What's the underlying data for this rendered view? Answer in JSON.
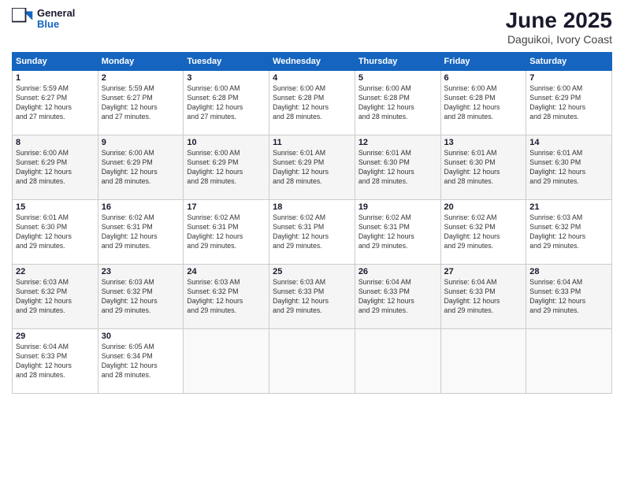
{
  "header": {
    "logo": {
      "general": "General",
      "blue": "Blue"
    },
    "title": "June 2025",
    "subtitle": "Daguikoi, Ivory Coast"
  },
  "weekdays": [
    "Sunday",
    "Monday",
    "Tuesday",
    "Wednesday",
    "Thursday",
    "Friday",
    "Saturday"
  ],
  "weeks": [
    [
      {
        "day": "1",
        "info": "Sunrise: 5:59 AM\nSunset: 6:27 PM\nDaylight: 12 hours\nand 27 minutes."
      },
      {
        "day": "2",
        "info": "Sunrise: 5:59 AM\nSunset: 6:27 PM\nDaylight: 12 hours\nand 27 minutes."
      },
      {
        "day": "3",
        "info": "Sunrise: 6:00 AM\nSunset: 6:28 PM\nDaylight: 12 hours\nand 27 minutes."
      },
      {
        "day": "4",
        "info": "Sunrise: 6:00 AM\nSunset: 6:28 PM\nDaylight: 12 hours\nand 28 minutes."
      },
      {
        "day": "5",
        "info": "Sunrise: 6:00 AM\nSunset: 6:28 PM\nDaylight: 12 hours\nand 28 minutes."
      },
      {
        "day": "6",
        "info": "Sunrise: 6:00 AM\nSunset: 6:28 PM\nDaylight: 12 hours\nand 28 minutes."
      },
      {
        "day": "7",
        "info": "Sunrise: 6:00 AM\nSunset: 6:29 PM\nDaylight: 12 hours\nand 28 minutes."
      }
    ],
    [
      {
        "day": "8",
        "info": "Sunrise: 6:00 AM\nSunset: 6:29 PM\nDaylight: 12 hours\nand 28 minutes."
      },
      {
        "day": "9",
        "info": "Sunrise: 6:00 AM\nSunset: 6:29 PM\nDaylight: 12 hours\nand 28 minutes."
      },
      {
        "day": "10",
        "info": "Sunrise: 6:00 AM\nSunset: 6:29 PM\nDaylight: 12 hours\nand 28 minutes."
      },
      {
        "day": "11",
        "info": "Sunrise: 6:01 AM\nSunset: 6:29 PM\nDaylight: 12 hours\nand 28 minutes."
      },
      {
        "day": "12",
        "info": "Sunrise: 6:01 AM\nSunset: 6:30 PM\nDaylight: 12 hours\nand 28 minutes."
      },
      {
        "day": "13",
        "info": "Sunrise: 6:01 AM\nSunset: 6:30 PM\nDaylight: 12 hours\nand 28 minutes."
      },
      {
        "day": "14",
        "info": "Sunrise: 6:01 AM\nSunset: 6:30 PM\nDaylight: 12 hours\nand 29 minutes."
      }
    ],
    [
      {
        "day": "15",
        "info": "Sunrise: 6:01 AM\nSunset: 6:30 PM\nDaylight: 12 hours\nand 29 minutes."
      },
      {
        "day": "16",
        "info": "Sunrise: 6:02 AM\nSunset: 6:31 PM\nDaylight: 12 hours\nand 29 minutes."
      },
      {
        "day": "17",
        "info": "Sunrise: 6:02 AM\nSunset: 6:31 PM\nDaylight: 12 hours\nand 29 minutes."
      },
      {
        "day": "18",
        "info": "Sunrise: 6:02 AM\nSunset: 6:31 PM\nDaylight: 12 hours\nand 29 minutes."
      },
      {
        "day": "19",
        "info": "Sunrise: 6:02 AM\nSunset: 6:31 PM\nDaylight: 12 hours\nand 29 minutes."
      },
      {
        "day": "20",
        "info": "Sunrise: 6:02 AM\nSunset: 6:32 PM\nDaylight: 12 hours\nand 29 minutes."
      },
      {
        "day": "21",
        "info": "Sunrise: 6:03 AM\nSunset: 6:32 PM\nDaylight: 12 hours\nand 29 minutes."
      }
    ],
    [
      {
        "day": "22",
        "info": "Sunrise: 6:03 AM\nSunset: 6:32 PM\nDaylight: 12 hours\nand 29 minutes."
      },
      {
        "day": "23",
        "info": "Sunrise: 6:03 AM\nSunset: 6:32 PM\nDaylight: 12 hours\nand 29 minutes."
      },
      {
        "day": "24",
        "info": "Sunrise: 6:03 AM\nSunset: 6:32 PM\nDaylight: 12 hours\nand 29 minutes."
      },
      {
        "day": "25",
        "info": "Sunrise: 6:03 AM\nSunset: 6:33 PM\nDaylight: 12 hours\nand 29 minutes."
      },
      {
        "day": "26",
        "info": "Sunrise: 6:04 AM\nSunset: 6:33 PM\nDaylight: 12 hours\nand 29 minutes."
      },
      {
        "day": "27",
        "info": "Sunrise: 6:04 AM\nSunset: 6:33 PM\nDaylight: 12 hours\nand 29 minutes."
      },
      {
        "day": "28",
        "info": "Sunrise: 6:04 AM\nSunset: 6:33 PM\nDaylight: 12 hours\nand 29 minutes."
      }
    ],
    [
      {
        "day": "29",
        "info": "Sunrise: 6:04 AM\nSunset: 6:33 PM\nDaylight: 12 hours\nand 28 minutes."
      },
      {
        "day": "30",
        "info": "Sunrise: 6:05 AM\nSunset: 6:34 PM\nDaylight: 12 hours\nand 28 minutes."
      },
      {
        "day": "",
        "info": ""
      },
      {
        "day": "",
        "info": ""
      },
      {
        "day": "",
        "info": ""
      },
      {
        "day": "",
        "info": ""
      },
      {
        "day": "",
        "info": ""
      }
    ]
  ]
}
